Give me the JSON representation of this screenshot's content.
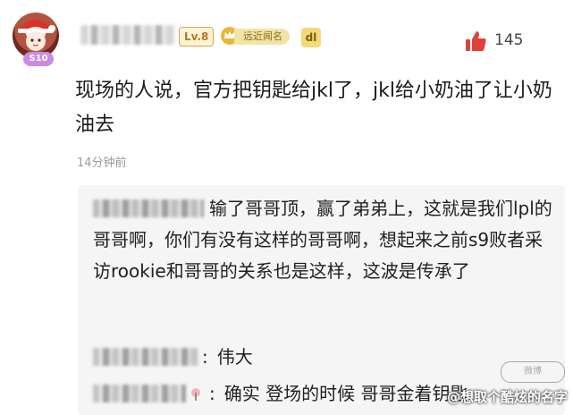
{
  "comment": {
    "avatar_badge": "S10",
    "level": "Lv.8",
    "rank_badge": "远近闻名",
    "fan_badge": "dl",
    "like_count": "145",
    "text": "现场的人说，官方把钥匙给jkl了，jkl给小奶油了让小奶油去",
    "time": "14分钟前"
  },
  "replies": [
    {
      "text": "输了哥哥顶，赢了弟弟上，这就是我们lpl的哥哥啊，你们有没有这样的哥哥啊，想起来之前s9败者采访rookie和哥哥的关系也是这样，这波是传承了"
    },
    {
      "text": "伟大"
    },
    {
      "text": "确实 登场的时候 哥哥金着钥匙"
    }
  ],
  "watermark": {
    "text": "@想取个酷炫的名字",
    "logo": "微博"
  },
  "icons": {
    "like": "thumbs-up-icon",
    "rank": "crown-icon"
  },
  "colors": {
    "like": "#e0403a",
    "level_border": "#d6a645",
    "reply_bg": "#f5f5f5"
  }
}
